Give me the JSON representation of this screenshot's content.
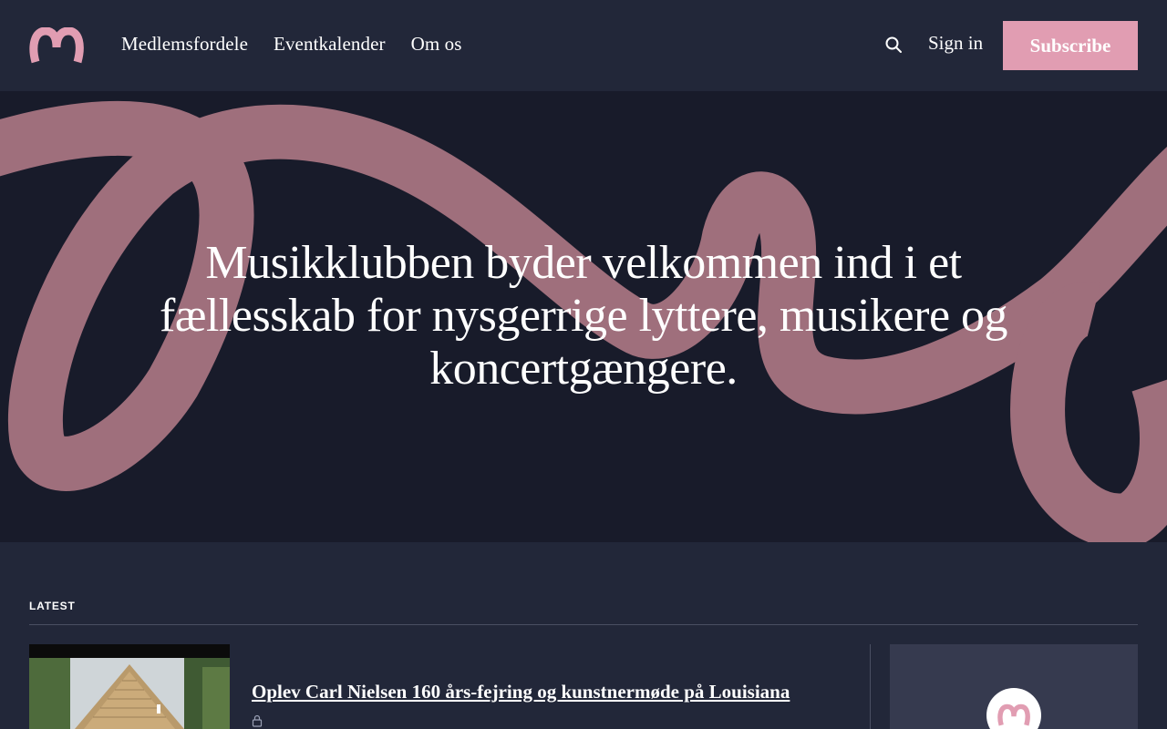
{
  "header": {
    "logo_icon": "musikklubben-logo-icon",
    "nav": [
      {
        "label": "Medlemsfordele"
      },
      {
        "label": "Eventkalender"
      },
      {
        "label": "Om os"
      }
    ],
    "search_icon": "search-icon",
    "signin_label": "Sign in",
    "subscribe_label": "Subscribe"
  },
  "hero": {
    "title": "Musikklubben byder velkommen ind i et fællesskab for nysgerrige lyttere, musikere og koncertgængere."
  },
  "latest": {
    "label": "LATEST",
    "posts": [
      {
        "title": "Oplev Carl Nielsen 160 års-fejring og kunstnermøde på Louisiana",
        "access_icon": "lock-icon"
      }
    ]
  },
  "colors": {
    "background": "#222739",
    "hero_background": "#181b2a",
    "accent": "#e19db2",
    "squiggle": "#9f6f7c",
    "card": "#363a4f"
  }
}
